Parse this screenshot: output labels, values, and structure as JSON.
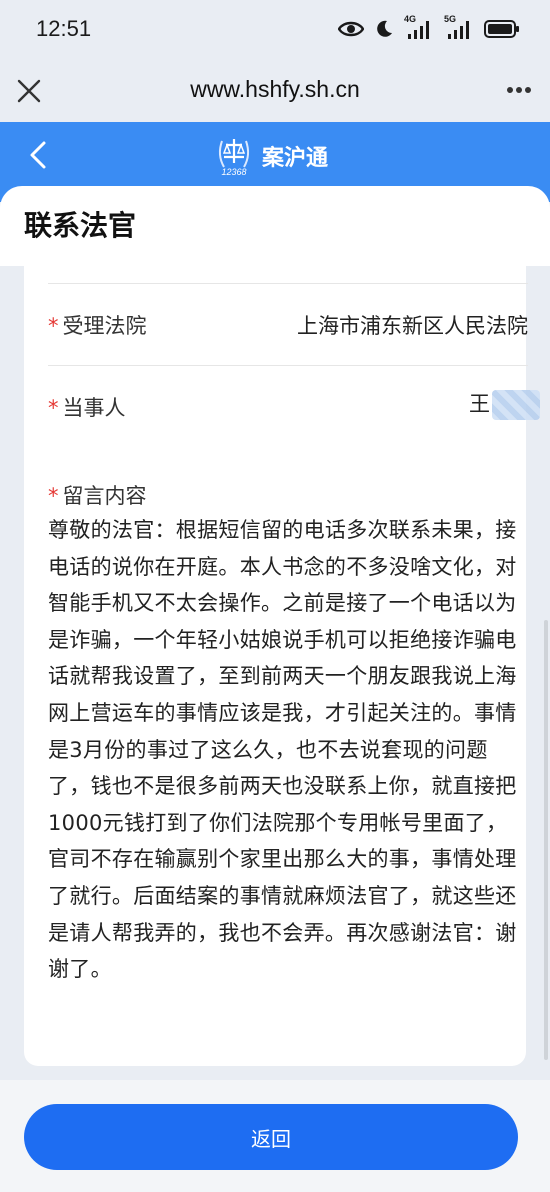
{
  "status_bar": {
    "time": "12:51",
    "network_1": "4G",
    "network_2": "5G",
    "icons": [
      "eye-icon",
      "moon-icon",
      "signal-icon",
      "signal-icon",
      "battery-icon"
    ]
  },
  "browser": {
    "url": "www.hshfy.sh.cn",
    "close_icon": "close-icon",
    "more_icon": "more-icon"
  },
  "app_header": {
    "title": "案沪通",
    "logo_text": "12368",
    "back_icon": "chevron-left-icon",
    "background": "#3a8cf3"
  },
  "page": {
    "title": "联系法官"
  },
  "form": {
    "court": {
      "label": "受理法院",
      "value": "上海市浦东新区人民法院"
    },
    "party": {
      "label": "当事人",
      "value": "王"
    },
    "message": {
      "label": "留言内容",
      "content": "尊敬的法官：根据短信留的电话多次联系未果，接电话的说你在开庭。本人书念的不多没啥文化，对智能手机又不太会操作。之前是接了一个电话以为是诈骗，一个年轻小姑娘说手机可以拒绝接诈骗电话就帮我设置了，至到前两天一个朋友跟我说上海网上营运车的事情应该是我，才引起关注的。事情是3月份的事过了这么久，也不去说套现的问题了，钱也不是很多前两天也没联系上你，就直接把1000元钱打到了你们法院那个专用帐号里面了，官司不存在输赢别个家里出那么大的事，事情处理了就行。后面结案的事情就麻烦法官了，就这些还是请人帮我弄的，我也不会弄。再次感谢法官：谢谢了。"
    },
    "required_mark": "*"
  },
  "footer": {
    "return_label": "返回",
    "button_color": "#1e6df2"
  }
}
